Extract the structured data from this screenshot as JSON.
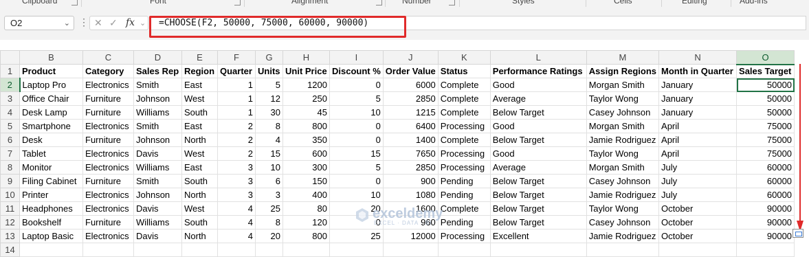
{
  "ribbon": {
    "groups": [
      "Clipboard",
      "Font",
      "Alignment",
      "Number",
      "Styles",
      "Cells",
      "Editing",
      "Add-ins"
    ]
  },
  "formula_bar": {
    "name_box": "O2",
    "formula": "=CHOOSE(F2, 50000, 75000, 60000, 90000)",
    "highlight_color": "#e02a2a"
  },
  "sheet": {
    "columns": [
      "B",
      "C",
      "D",
      "E",
      "F",
      "G",
      "H",
      "I",
      "J",
      "K",
      "L",
      "M",
      "N",
      "O"
    ],
    "selected_column": "O",
    "selected_row": "2",
    "row_numbers": [
      "1",
      "2",
      "3",
      "4",
      "5",
      "6",
      "7",
      "8",
      "9",
      "10",
      "11",
      "12",
      "13",
      "14"
    ],
    "headers": [
      "Product",
      "Category",
      "Sales Rep",
      "Region",
      "Quarter",
      "Units",
      "Unit Price",
      "Discount %",
      "Order Value",
      "Status",
      "Performance Ratings",
      "Assign Regions",
      "Month in Quarter",
      "Sales Target"
    ],
    "rows": [
      [
        "Laptop Pro",
        "Electronics",
        "Smith",
        "East",
        "1",
        "5",
        "1200",
        "0",
        "6000",
        "Complete",
        "Good",
        "Morgan Smith",
        "January",
        "50000"
      ],
      [
        "Office Chair",
        "Furniture",
        "Johnson",
        "West",
        "1",
        "12",
        "250",
        "5",
        "2850",
        "Complete",
        "Average",
        "Taylor Wong",
        "January",
        "50000"
      ],
      [
        "Desk Lamp",
        "Furniture",
        "Williams",
        "South",
        "1",
        "30",
        "45",
        "10",
        "1215",
        "Complete",
        "Below Target",
        "Casey Johnson",
        "January",
        "50000"
      ],
      [
        "Smartphone",
        "Electronics",
        "Smith",
        "East",
        "2",
        "8",
        "800",
        "0",
        "6400",
        "Processing",
        "Good",
        "Morgan Smith",
        "April",
        "75000"
      ],
      [
        "Desk",
        "Furniture",
        "Johnson",
        "North",
        "2",
        "4",
        "350",
        "0",
        "1400",
        "Complete",
        "Below Target",
        "Jamie Rodriguez",
        "April",
        "75000"
      ],
      [
        "Tablet",
        "Electronics",
        "Davis",
        "West",
        "2",
        "15",
        "600",
        "15",
        "7650",
        "Processing",
        "Good",
        "Taylor Wong",
        "April",
        "75000"
      ],
      [
        "Monitor",
        "Electronics",
        "Williams",
        "East",
        "3",
        "10",
        "300",
        "5",
        "2850",
        "Processing",
        "Average",
        "Morgan Smith",
        "July",
        "60000"
      ],
      [
        "Filing Cabinet",
        "Furniture",
        "Smith",
        "South",
        "3",
        "6",
        "150",
        "0",
        "900",
        "Pending",
        "Below Target",
        "Casey Johnson",
        "July",
        "60000"
      ],
      [
        "Printer",
        "Electronics",
        "Johnson",
        "North",
        "3",
        "3",
        "400",
        "10",
        "1080",
        "Pending",
        "Below Target",
        "Jamie Rodriguez",
        "July",
        "60000"
      ],
      [
        "Headphones",
        "Electronics",
        "Davis",
        "West",
        "4",
        "25",
        "80",
        "20",
        "1600",
        "Complete",
        "Below Target",
        "Taylor Wong",
        "October",
        "90000"
      ],
      [
        "Bookshelf",
        "Furniture",
        "Williams",
        "South",
        "4",
        "8",
        "120",
        "0",
        "960",
        "Pending",
        "Below Target",
        "Casey Johnson",
        "October",
        "90000"
      ],
      [
        "Laptop Basic",
        "Electronics",
        "Davis",
        "North",
        "4",
        "20",
        "800",
        "25",
        "12000",
        "Processing",
        "Excellent",
        "Jamie Rodriguez",
        "October",
        "90000"
      ]
    ]
  },
  "watermark": {
    "name": "exceldemy",
    "tagline": "EXCEL · DATA · BI"
  },
  "colors": {
    "accent_green": "#217346",
    "arrow_red": "#e02a2a"
  }
}
